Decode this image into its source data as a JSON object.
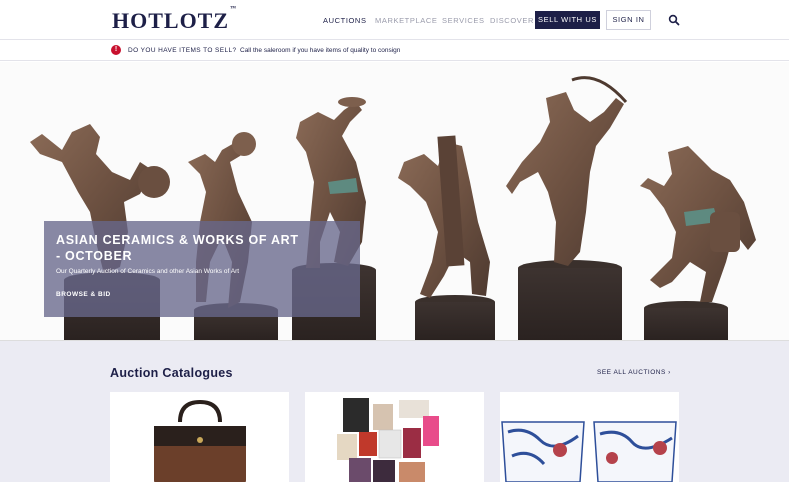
{
  "header": {
    "logo": "HOTLOTZ",
    "logo_tm": "™",
    "nav": [
      {
        "label": "AUCTIONS",
        "active": true
      },
      {
        "label": "MARKETPLACE",
        "active": false
      },
      {
        "label": "SERVICES",
        "active": false
      },
      {
        "label": "DISCOVER",
        "active": false
      }
    ],
    "sell_button": "SELL WITH US",
    "signin_button": "SIGN IN",
    "search_icon": "search-icon"
  },
  "notice": {
    "icon": "alert-icon",
    "icon_glyph": "!",
    "question": "DO YOU HAVE ITEMS TO SELL?",
    "message": "Call the saleroom if you have items of quality to consign"
  },
  "hero": {
    "title": "ASIAN CERAMICS & WORKS OF ART - OCTOBER",
    "subtitle": "Our Quarterly Auction of Ceramics and other Asian Works of Art",
    "cta": "BROWSE & BID",
    "slide_count": 8,
    "active_slide": 1
  },
  "catalogues": {
    "title": "Auction Catalogues",
    "see_all": "SEE ALL AUCTIONS ›"
  },
  "colors": {
    "brand_navy": "#1d1f47",
    "alert_red": "#c8102e",
    "section_bg": "#ebebf3"
  }
}
